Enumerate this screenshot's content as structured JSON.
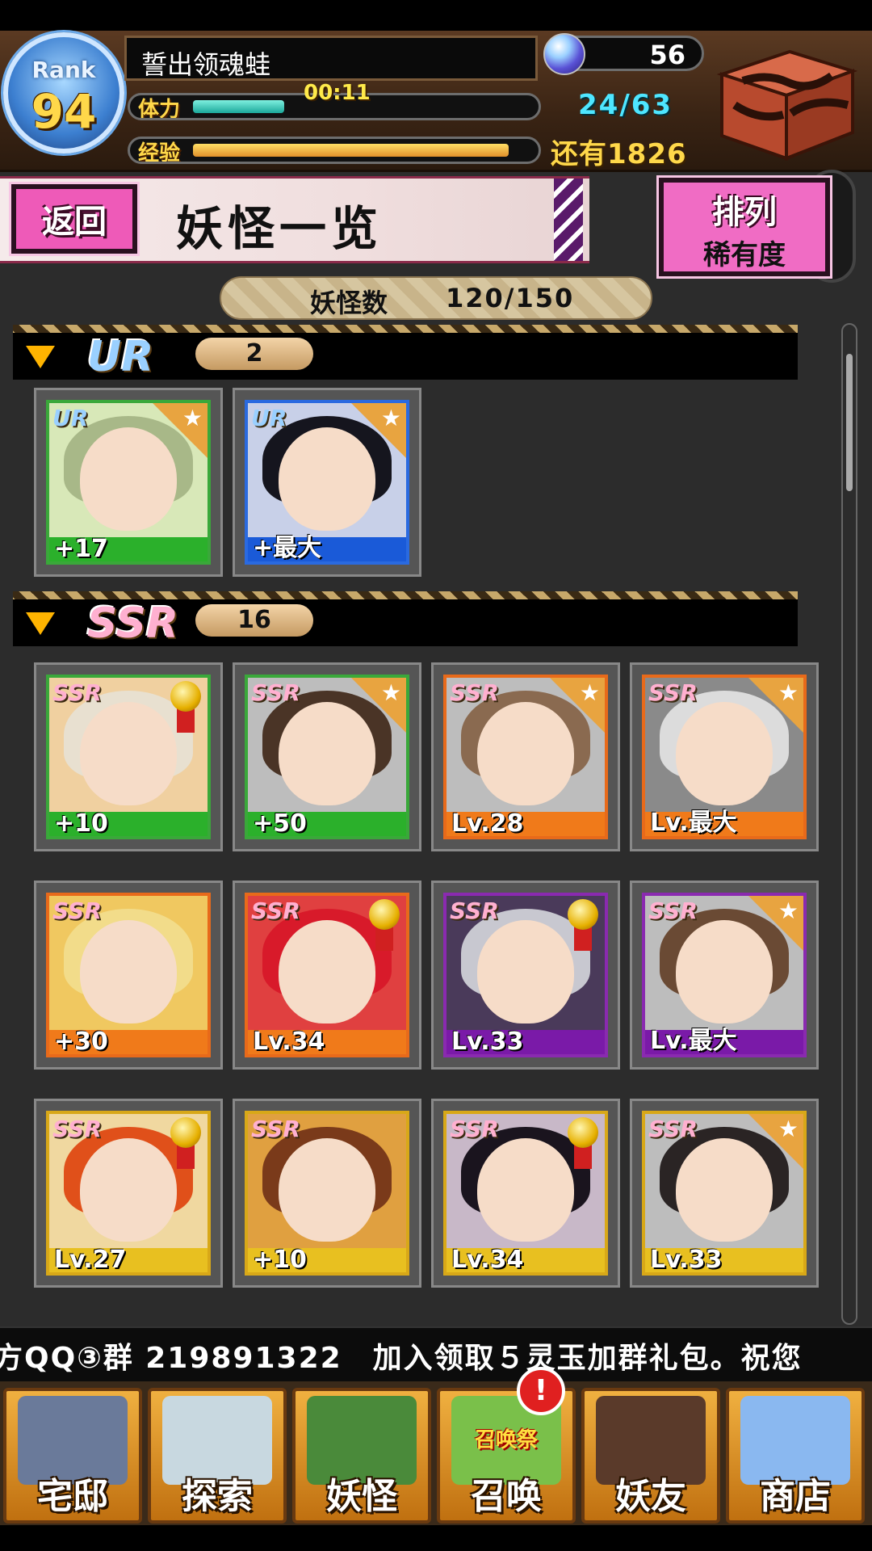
{
  "header": {
    "rank_label": "Rank",
    "rank_value": "94",
    "player_name": "誓出领魂蛙",
    "stamina_label": "体力",
    "stamina_timer": "00:11",
    "stamina_fill": 0.27,
    "stamina_count": "24/63",
    "exp_label": "经验",
    "exp_fill": 0.93,
    "exp_remaining": "还有1826",
    "gem_count": "56"
  },
  "title_bar": {
    "back_label": "返回",
    "title": "妖怪一览",
    "sort_label": "排列",
    "sort_value": "稀有度"
  },
  "count": {
    "label": "妖怪数",
    "value": "120/150"
  },
  "sections": [
    {
      "rarity": "UR",
      "count": "2",
      "cards": [
        {
          "rarity": "UR",
          "level": "+17",
          "frame": "#3aa83a",
          "strip": "#2bb02b",
          "hair": "#a8b888",
          "bg": "#d8e8b8",
          "corner": "star"
        },
        {
          "rarity": "UR",
          "level": "+最大",
          "frame": "#2a6ae0",
          "strip": "#1a5ad8",
          "hair": "#15151e",
          "bg": "#c8d0e8",
          "corner": "star"
        }
      ]
    },
    {
      "rarity": "SSR",
      "count": "16",
      "cards": [
        {
          "rarity": "SSR",
          "level": "+10",
          "frame": "#3aa83a",
          "strip": "#2bb02b",
          "hair": "#e8e0d0",
          "bg": "#f0d0a0",
          "corner": "medal"
        },
        {
          "rarity": "SSR",
          "level": "+50",
          "frame": "#3aa83a",
          "strip": "#2bb02b",
          "hair": "#4a3426",
          "bg": "#bdbdbd",
          "corner": "star"
        },
        {
          "rarity": "SSR",
          "level": "Lv.28",
          "frame": "#e86a1a",
          "strip": "#f07a1a",
          "hair": "#8a6a50",
          "bg": "#bdbdbd",
          "corner": "star"
        },
        {
          "rarity": "SSR",
          "level": "Lv.最大",
          "frame": "#e86a1a",
          "strip": "#f07a1a",
          "hair": "#dcdcdc",
          "bg": "#8a8a8a",
          "corner": "star"
        },
        {
          "rarity": "SSR",
          "level": "+30",
          "frame": "#e86a1a",
          "strip": "#f07a1a",
          "hair": "#f2dc8a",
          "bg": "#f0c860",
          "corner": "none"
        },
        {
          "rarity": "SSR",
          "level": "Lv.34",
          "frame": "#e86a1a",
          "strip": "#f07a1a",
          "hair": "#d81a2a",
          "bg": "#e04040",
          "corner": "medal"
        },
        {
          "rarity": "SSR",
          "level": "Lv.33",
          "frame": "#8a2ab0",
          "strip": "#7a1aa8",
          "hair": "#c8c8d0",
          "bg": "#4a3a5a",
          "corner": "medal"
        },
        {
          "rarity": "SSR",
          "level": "Lv.最大",
          "frame": "#8a2ab0",
          "strip": "#7a1aa8",
          "hair": "#6a4a34",
          "bg": "#bdbdbd",
          "corner": "star"
        },
        {
          "rarity": "SSR",
          "level": "Lv.27",
          "frame": "#d8a818",
          "strip": "#e8c020",
          "hair": "#e0501a",
          "bg": "#f0d8a0",
          "corner": "medal"
        },
        {
          "rarity": "SSR",
          "level": "+10",
          "frame": "#d8a818",
          "strip": "#e8c020",
          "hair": "#7a3a1a",
          "bg": "#e0a040",
          "corner": "none"
        },
        {
          "rarity": "SSR",
          "level": "Lv.34",
          "frame": "#d8a818",
          "strip": "#e8c020",
          "hair": "#1a141e",
          "bg": "#c8b8c8",
          "corner": "medal"
        },
        {
          "rarity": "SSR",
          "level": "Lv.33",
          "frame": "#d8a818",
          "strip": "#e8c020",
          "hair": "#2a2424",
          "bg": "#bdbdbd",
          "corner": "star"
        }
      ]
    }
  ],
  "marquee": "方QQ③群 219891322　加入领取５灵玉加群礼包。祝您",
  "nav": [
    {
      "label": "宅邸",
      "icon": "mansion-icon",
      "art": "#6a7a9a"
    },
    {
      "label": "探索",
      "icon": "magnifier-icon",
      "art": "#c8d8e0"
    },
    {
      "label": "妖怪",
      "icon": "scroll-icon",
      "art": "#4a8a3a"
    },
    {
      "label": "召唤",
      "icon": "summon-icon",
      "art": "#7ac04a",
      "badge": "!",
      "festival": "召唤祭"
    },
    {
      "label": "妖友",
      "icon": "friend-icon",
      "art": "#5a3a2a"
    },
    {
      "label": "商店",
      "icon": "crystal-orb-icon",
      "art": "#8ab8f0"
    }
  ],
  "colors": {
    "ur_text": "#9ad0ff",
    "ssr_text": "#ffb0d0",
    "back_button": "#ee5ab8",
    "sort_button": "#f06cc4",
    "stamina_count": "#4ee6ff"
  }
}
